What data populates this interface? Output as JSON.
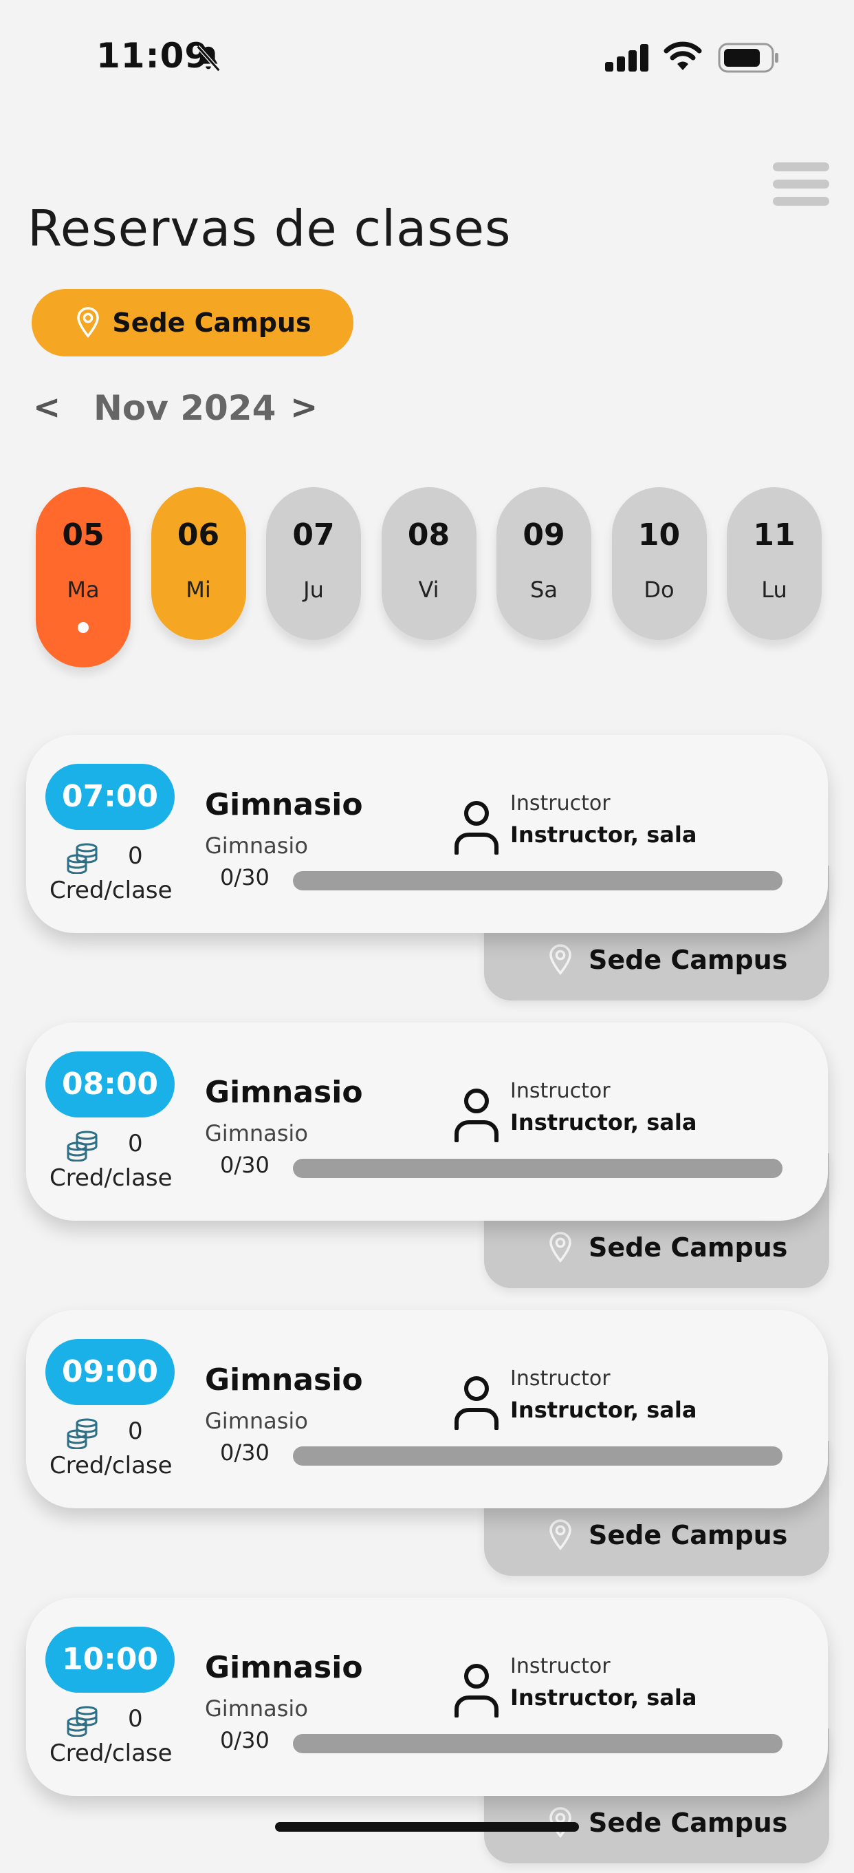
{
  "status_bar": {
    "time": "11:09"
  },
  "header": {
    "title": "Reservas de clases",
    "location_label": "Sede Campus"
  },
  "calendar": {
    "month_label": "Nov 2024",
    "prev_label": "<",
    "next_label": ">",
    "days": [
      {
        "num": "05",
        "name": "Ma",
        "state": "selected"
      },
      {
        "num": "06",
        "name": "Mi",
        "state": "today"
      },
      {
        "num": "07",
        "name": "Ju",
        "state": "normal"
      },
      {
        "num": "08",
        "name": "Vi",
        "state": "normal"
      },
      {
        "num": "09",
        "name": "Sa",
        "state": "normal"
      },
      {
        "num": "10",
        "name": "Do",
        "state": "normal"
      },
      {
        "num": "11",
        "name": "Lu",
        "state": "normal"
      }
    ]
  },
  "classes": [
    {
      "time": "07:00",
      "credits": "0",
      "credits_label": "Cred/clase",
      "name": "Gimnasio",
      "category": "Gimnasio",
      "capacity": "0/30",
      "booked_fraction": 0,
      "instructor_label": "Instructor",
      "instructor_name": "Instructor, sala",
      "location": "Sede Campus"
    },
    {
      "time": "08:00",
      "credits": "0",
      "credits_label": "Cred/clase",
      "name": "Gimnasio",
      "category": "Gimnasio",
      "capacity": "0/30",
      "booked_fraction": 0,
      "instructor_label": "Instructor",
      "instructor_name": "Instructor, sala",
      "location": "Sede Campus"
    },
    {
      "time": "09:00",
      "credits": "0",
      "credits_label": "Cred/clase",
      "name": "Gimnasio",
      "category": "Gimnasio",
      "capacity": "0/30",
      "booked_fraction": 0,
      "instructor_label": "Instructor",
      "instructor_name": "Instructor, sala",
      "location": "Sede Campus"
    },
    {
      "time": "10:00",
      "credits": "0",
      "credits_label": "Cred/clase",
      "name": "Gimnasio",
      "category": "Gimnasio",
      "capacity": "0/30",
      "booked_fraction": 0,
      "instructor_label": "Instructor",
      "instructor_name": "Instructor, sala",
      "location": "Sede Campus"
    }
  ],
  "colors": {
    "accent_orange": "#f5a623",
    "selected_day": "#ff6a2c",
    "time_badge": "#1ab0e8",
    "day_inactive": "#cfcfcf"
  },
  "icons": {
    "bell": "bell-slash-icon",
    "signal": "cellular-signal-icon",
    "wifi": "wifi-icon",
    "battery": "battery-icon",
    "menu": "hamburger-menu-icon",
    "location": "map-pin-icon",
    "coins": "coins-stack-icon",
    "person": "person-icon"
  }
}
